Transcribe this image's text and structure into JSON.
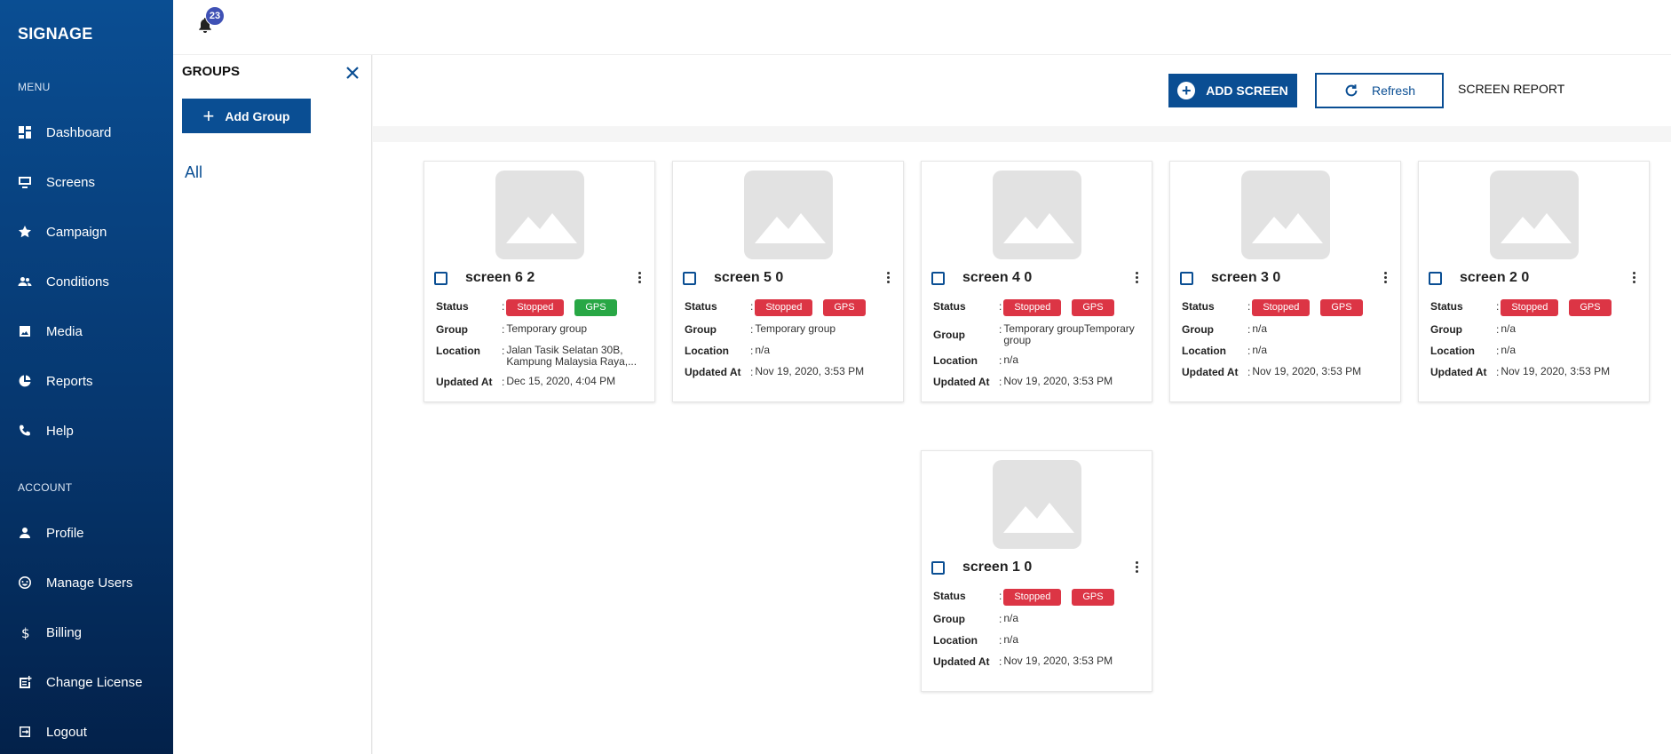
{
  "app": {
    "brand": "SIGNAGE",
    "notification_count": "23"
  },
  "sidebar": {
    "menu_label": "MENU",
    "account_label": "ACCOUNT",
    "menu_items": [
      {
        "label": "Dashboard",
        "icon": "dashboard-icon"
      },
      {
        "label": "Screens",
        "icon": "monitor-icon"
      },
      {
        "label": "Campaign",
        "icon": "star-icon"
      },
      {
        "label": "Conditions",
        "icon": "people-icon"
      },
      {
        "label": "Media",
        "icon": "image-icon"
      },
      {
        "label": "Reports",
        "icon": "pie-chart-icon"
      },
      {
        "label": "Help",
        "icon": "phone-icon"
      }
    ],
    "account_items": [
      {
        "label": "Profile",
        "icon": "person-icon"
      },
      {
        "label": "Manage Users",
        "icon": "smiley-icon"
      },
      {
        "label": "Billing",
        "icon": "dollar-icon"
      },
      {
        "label": "Change License",
        "icon": "license-icon"
      },
      {
        "label": "Logout",
        "icon": "logout-icon"
      }
    ]
  },
  "groups": {
    "title": "GROUPS",
    "add_label": "Add Group",
    "items": [
      "All"
    ]
  },
  "toolbar": {
    "add_screen_label": "ADD SCREEN",
    "refresh_label": "Refresh",
    "report_label": "SCREEN REPORT"
  },
  "fields": {
    "status": "Status",
    "group": "Group",
    "location": "Location",
    "updated": "Updated At"
  },
  "screens": [
    {
      "name": "screen 6 2",
      "status": "Stopped",
      "gps": "GPS",
      "gps_color": "#28a745",
      "group": "Temporary group",
      "location": "Jalan Tasik Selatan 30B, Kampung Malaysia Raya,...",
      "updated": "Dec 15, 2020, 4:04 PM"
    },
    {
      "name": "screen 5 0",
      "status": "Stopped",
      "gps": "GPS",
      "gps_color": "#dc3545",
      "group": "Temporary group",
      "location": "n/a",
      "updated": "Nov 19, 2020, 3:53 PM"
    },
    {
      "name": "screen 4 0",
      "status": "Stopped",
      "gps": "GPS",
      "gps_color": "#dc3545",
      "group": "Temporary groupTemporary group",
      "location": "n/a",
      "updated": "Nov 19, 2020, 3:53 PM"
    },
    {
      "name": "screen 3 0",
      "status": "Stopped",
      "gps": "GPS",
      "gps_color": "#dc3545",
      "group": "n/a",
      "location": "n/a",
      "updated": "Nov 19, 2020, 3:53 PM"
    },
    {
      "name": "screen 2 0",
      "status": "Stopped",
      "gps": "GPS",
      "gps_color": "#dc3545",
      "group": "n/a",
      "location": "n/a",
      "updated": "Nov 19, 2020, 3:53 PM"
    },
    {
      "name": "screen 1 0",
      "status": "Stopped",
      "gps": "GPS",
      "gps_color": "#dc3545",
      "group": "n/a",
      "location": "n/a",
      "updated": "Nov 19, 2020, 3:53 PM"
    }
  ],
  "colors": {
    "primary": "#0a4e93",
    "stopped": "#dc3545",
    "gps_ok": "#28a745",
    "badge": "#3f51b5"
  }
}
